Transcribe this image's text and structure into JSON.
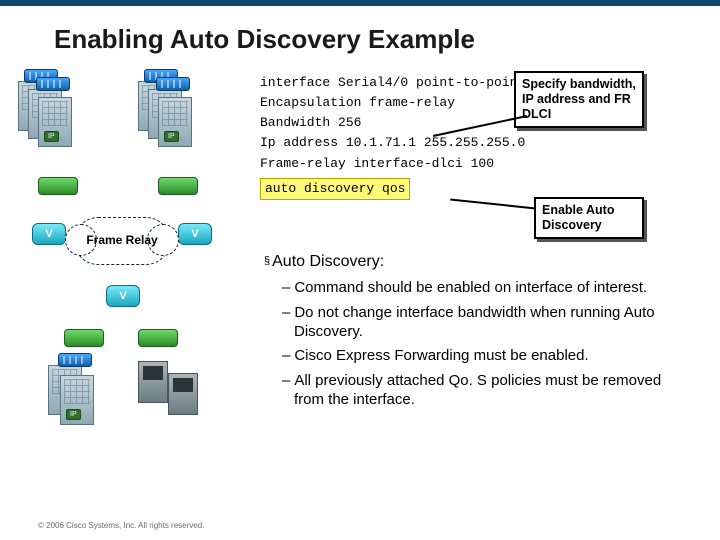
{
  "title": "Enabling Auto Discovery Example",
  "code": {
    "l1": "interface Serial4/0 point-to-point",
    "l2": "Encapsulation frame-relay",
    "l3": "Bandwidth 256",
    "l4": "Ip address 10.1.71.1 255.255.255.0",
    "l5": "Frame-relay interface-dlci 100",
    "l6": "auto discovery qos"
  },
  "callouts": {
    "c1": "Specify bandwidth, IP address and FR DLCI",
    "c2": "Enable Auto Discovery"
  },
  "bullets": {
    "heading": "Auto Discovery:",
    "items": [
      "Command should be enabled on interface of interest.",
      "Do not change interface bandwidth when running Auto Discovery.",
      "Cisco Express Forwarding must be enabled.",
      "All previously attached Qo. S policies must be removed from the interface."
    ]
  },
  "diagram": {
    "cloud": "Frame Relay",
    "ip": "IP",
    "v": "V"
  },
  "footer": "© 2006 Cisco Systems, Inc. All rights reserved."
}
